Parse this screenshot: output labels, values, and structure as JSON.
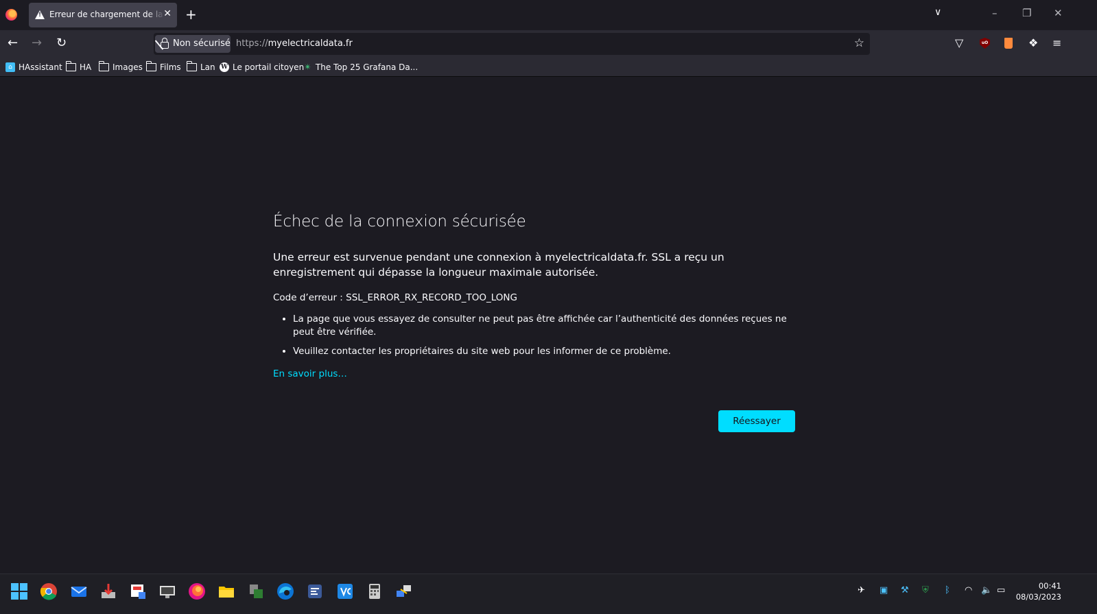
{
  "window": {
    "tab_title": "Erreur de chargement de la page",
    "controls": {
      "minimize": "–",
      "restore": "❐",
      "close": "✕"
    },
    "new_tab": "+",
    "list_tabs": "⌄"
  },
  "navbar": {
    "security_label": "Non sécurisé",
    "url_scheme": "https://",
    "url_host": "myelectricaldata.fr"
  },
  "bookmarks": [
    {
      "label": "HAssistant",
      "icon": "home-assistant-icon"
    },
    {
      "label": "HA",
      "icon": "folder-icon"
    },
    {
      "label": "Images",
      "icon": "folder-icon"
    },
    {
      "label": "Films",
      "icon": "folder-icon"
    },
    {
      "label": "Lan",
      "icon": "folder-icon"
    },
    {
      "label": "Le portail citoyen",
      "icon": "wordpress-icon"
    },
    {
      "label": "The Top 25 Grafana Da...",
      "icon": "grafana-icon"
    }
  ],
  "error": {
    "title": "Échec de la connexion sécurisée",
    "description": "Une erreur est survenue pendant une connexion à myelectricaldata.fr. SSL a reçu un enregistrement qui dépasse la longueur maximale autorisée.",
    "code_line": "Code d’erreur : SSL_ERROR_RX_RECORD_TOO_LONG",
    "bullets": [
      "La page que vous essayez de consulter ne peut pas être affichée car l’authenticité des données reçues ne peut être vérifiée.",
      "Veuillez contacter les propriétaires du site web pour les informer de ce problème."
    ],
    "learn_more": "En savoir plus…",
    "retry_button": "Réessayer"
  },
  "taskbar": {
    "time": "00:41",
    "date": "08/03/2023"
  },
  "colors": {
    "page_bg": "#1c1b22",
    "toolbar_bg": "#2b2a33",
    "accent": "#00ddff"
  }
}
